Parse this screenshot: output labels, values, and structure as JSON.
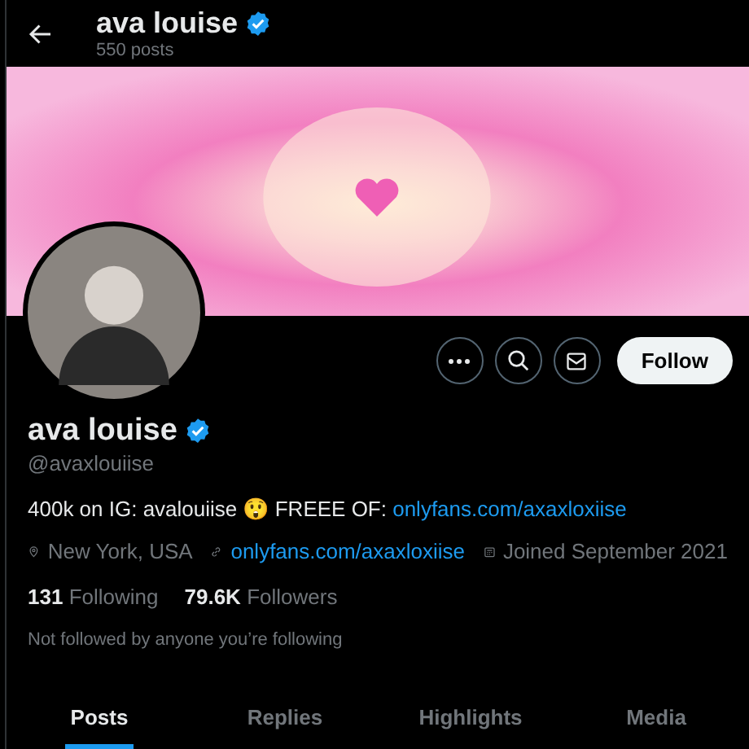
{
  "header": {
    "title": "ava louise",
    "verified": true,
    "subtitle": "550 posts"
  },
  "actions": {
    "follow_label": "Follow"
  },
  "profile": {
    "name": "ava louise",
    "verified": true,
    "handle": "@avaxlouiise",
    "bio": [
      {
        "kind": "text",
        "text": "400k on IG: avalouiise 😲 FREEE OF: "
      },
      {
        "kind": "link",
        "text": "onlyfans.com/axaxloxiise"
      }
    ],
    "location": "New York, USA",
    "website": "onlyfans.com/axaxloxiise",
    "joined": "Joined September 2021",
    "following_count": "131",
    "following_label": "Following",
    "followers_count": "79.6K",
    "followers_label": "Followers",
    "note": "Not followed by anyone you’re following"
  },
  "tabs": [
    {
      "label": "Posts",
      "selected": true
    },
    {
      "label": "Replies",
      "selected": false
    },
    {
      "label": "Highlights",
      "selected": false
    },
    {
      "label": "Media",
      "selected": false
    }
  ]
}
